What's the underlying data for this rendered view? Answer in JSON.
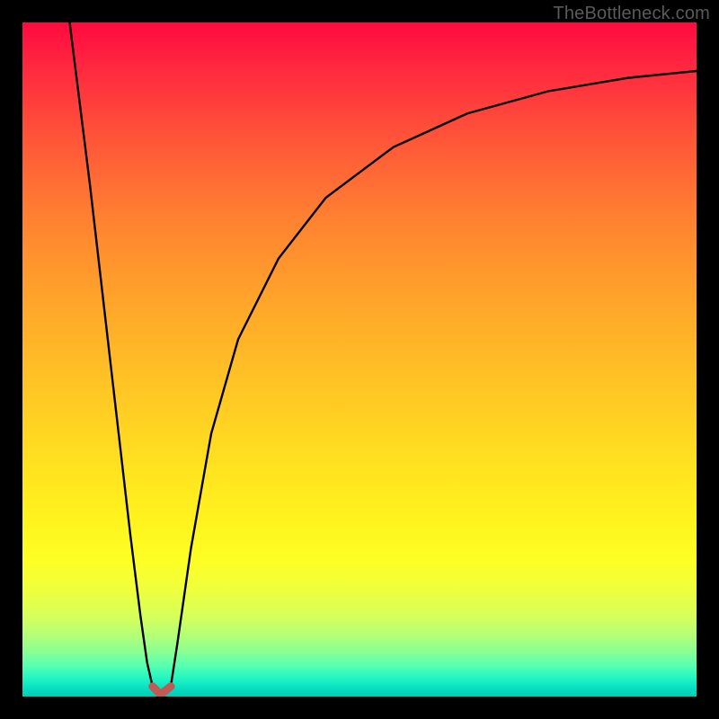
{
  "watermark": "TheBottleneck.com",
  "chart_data": {
    "type": "line",
    "title": "",
    "xlabel": "",
    "ylabel": "",
    "xlim": [
      0,
      100
    ],
    "ylim": [
      0,
      100
    ],
    "background_gradient": {
      "top": "#ff0a3f",
      "bottom": "#03cbb5",
      "stops": [
        "red",
        "orange",
        "yellow",
        "green"
      ]
    },
    "series": [
      {
        "name": "left-branch",
        "description": "steep descending curve from top-left down to minimum",
        "x": [
          7.0,
          8.5,
          10.0,
          11.5,
          13.0,
          14.5,
          16.0,
          17.5,
          18.5,
          19.3
        ],
        "values": [
          100.0,
          88.0,
          76.0,
          63.0,
          50.0,
          37.0,
          24.0,
          12.0,
          5.0,
          1.5
        ]
      },
      {
        "name": "right-branch",
        "description": "ascending curve rising from minimum toward upper-right with decreasing slope",
        "x": [
          22.0,
          23.0,
          25.0,
          28.0,
          32.0,
          38.0,
          45.0,
          55.0,
          66.0,
          78.0,
          90.0,
          100.0
        ],
        "values": [
          1.5,
          8.0,
          22.0,
          39.0,
          53.0,
          65.0,
          74.0,
          81.5,
          86.5,
          89.8,
          91.8,
          92.8
        ]
      },
      {
        "name": "minimum-marker",
        "description": "small U-shaped marker at the curve minimum",
        "x": [
          19.3,
          20.5,
          22.0
        ],
        "values": [
          1.5,
          0.3,
          1.5
        ],
        "color": "#c05a54",
        "stroke_width": 9
      }
    ],
    "minimum": {
      "x": 20.5,
      "y": 0.3
    }
  }
}
